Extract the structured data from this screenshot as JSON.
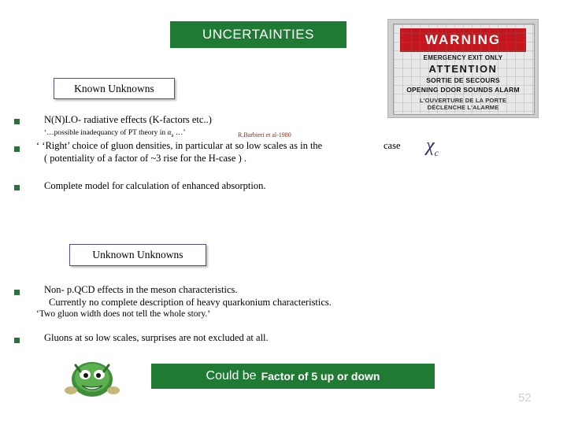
{
  "slide": {
    "title": "UNCERTAINTIES",
    "page_number": "52",
    "title_bg": "#1f7a33"
  },
  "warning_sign": {
    "header": "WARNING",
    "line1": "EMERGENCY EXIT ONLY",
    "line2": "ATTENTION",
    "line3": "SORTIE DE SECOURS",
    "line4": "OPENING DOOR SOUNDS ALARM",
    "line5": "L'OUVERTURE DE LA PORTE DÉCLENCHE L'ALARME",
    "red": "#c4161c"
  },
  "sections": {
    "known": {
      "label": "Known  Unknowns",
      "bullets": [
        "N(N)LO- radiative effects (K-factors etc..)",
        "‘ ‘Right’ choice of  gluon densities, in particular at so low scales as in the",
        "( potentiality of a factor of ~3 rise for the H-case ) .",
        "Complete model for calculation of enhanced absorption."
      ],
      "note": "‘…possible inadequancy of PT theory in αₛ …’",
      "note_plain": "‘…possible inadequancy of PT theory in ",
      "note_alpha": "α",
      "note_alpha_sub": "s",
      "note_tail": " …’",
      "reference": "R.Barbieri et al-1980",
      "case_word": "case",
      "chi_symbol": "χ",
      "chi_sub": "c"
    },
    "unknown": {
      "label": "Unknown  Unknowns",
      "bullets": [
        "Non- p.QCD effects in the meson characteristics.",
        "Currently no complete description of heavy quarkonium characteristics.",
        "‘Two gluon width does not tell the whole story.’",
        "Gluons at so low scales, surprises are not excluded at all."
      ]
    }
  },
  "bottom_banner": {
    "text_normal": "Could be",
    "text_bold": "Factor of 5 up or down",
    "bg": "#1f7a33"
  }
}
